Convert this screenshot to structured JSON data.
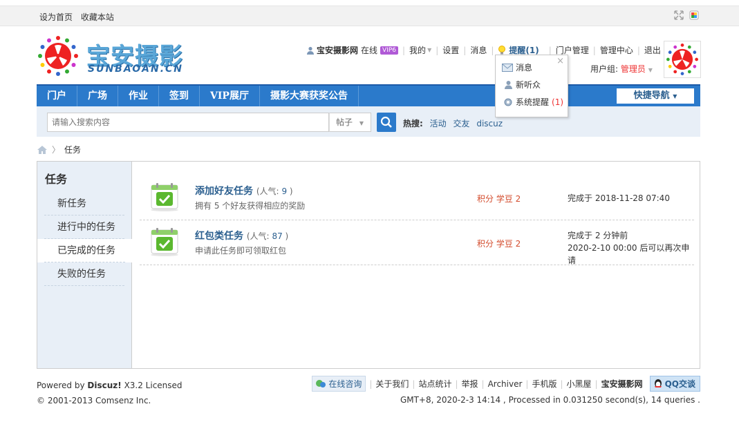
{
  "topbar": {
    "set_home": "设为首页",
    "bookmark": "收藏本站"
  },
  "logo": {
    "text": "宝安摄影",
    "sub": "SUNBAOAN.CN"
  },
  "user_menu": {
    "username": "宝安摄影网",
    "status": "在线",
    "vip": "VIP6",
    "my": "我的",
    "settings": "设置",
    "messages": "消息",
    "remind": "提醒(1)",
    "portal_manage": "门户管理",
    "admin_center": "管理中心",
    "logout": "退出",
    "group_label": "用户组:",
    "group_value": "管理员"
  },
  "dropdown": {
    "items": [
      {
        "label": "消息",
        "count": ""
      },
      {
        "label": "新听众",
        "count": ""
      },
      {
        "label": "系统提醒",
        "count": "(1)"
      }
    ]
  },
  "nav": {
    "items": [
      "门户",
      "广场",
      "作业",
      "签到",
      "VIP展厅",
      "摄影大赛获奖公告"
    ],
    "quick": "快捷导航"
  },
  "search": {
    "placeholder": "请输入搜索内容",
    "type": "帖子",
    "hot_label": "热搜:",
    "hot": [
      "活动",
      "交友",
      "discuz"
    ]
  },
  "breadcrumb": {
    "current": "任务"
  },
  "sidebar": {
    "title": "任务",
    "items": [
      "新任务",
      "进行中的任务",
      "已完成的任务",
      "失败的任务"
    ],
    "active_index": 2
  },
  "tasks": [
    {
      "name": "添加好友任务",
      "pop_label": "(人气:",
      "pop": "9",
      "pop_end": ")",
      "desc": "拥有 5 个好友获得相应的奖励",
      "reward": "积分 学豆 2",
      "done_line1": "完成于 2018-11-28 07:40",
      "done_line2": ""
    },
    {
      "name": "红包类任务",
      "pop_label": "(人气:",
      "pop": "87",
      "pop_end": ")",
      "desc": "申请此任务即可领取红包",
      "reward": "积分 学豆 2",
      "done_line1": "完成于 2 分钟前",
      "done_line2": "2020-2-10 00:00 后可以再次申请"
    }
  ],
  "footer": {
    "powered_prefix": "Powered by",
    "powered_brand": "Discuz!",
    "powered_suffix": "X3.2 Licensed",
    "copyright": "© 2001-2013 Comsenz Inc.",
    "online": "在线咨询",
    "links": [
      "关于我们",
      "站点统计",
      "举报",
      "Archiver",
      "手机版",
      "小黑屋"
    ],
    "site": "宝安摄影网",
    "qq": "QQ交谈",
    "processed": "GMT+8, 2020-2-3 14:14 , Processed in 0.031250 second(s), 14 queries ."
  },
  "colors": {
    "nav_blue": "#2b7acb",
    "link_blue": "#2b5f8f",
    "reward_red": "#d34b2c",
    "sidebar_bg": "#e8eff7"
  }
}
